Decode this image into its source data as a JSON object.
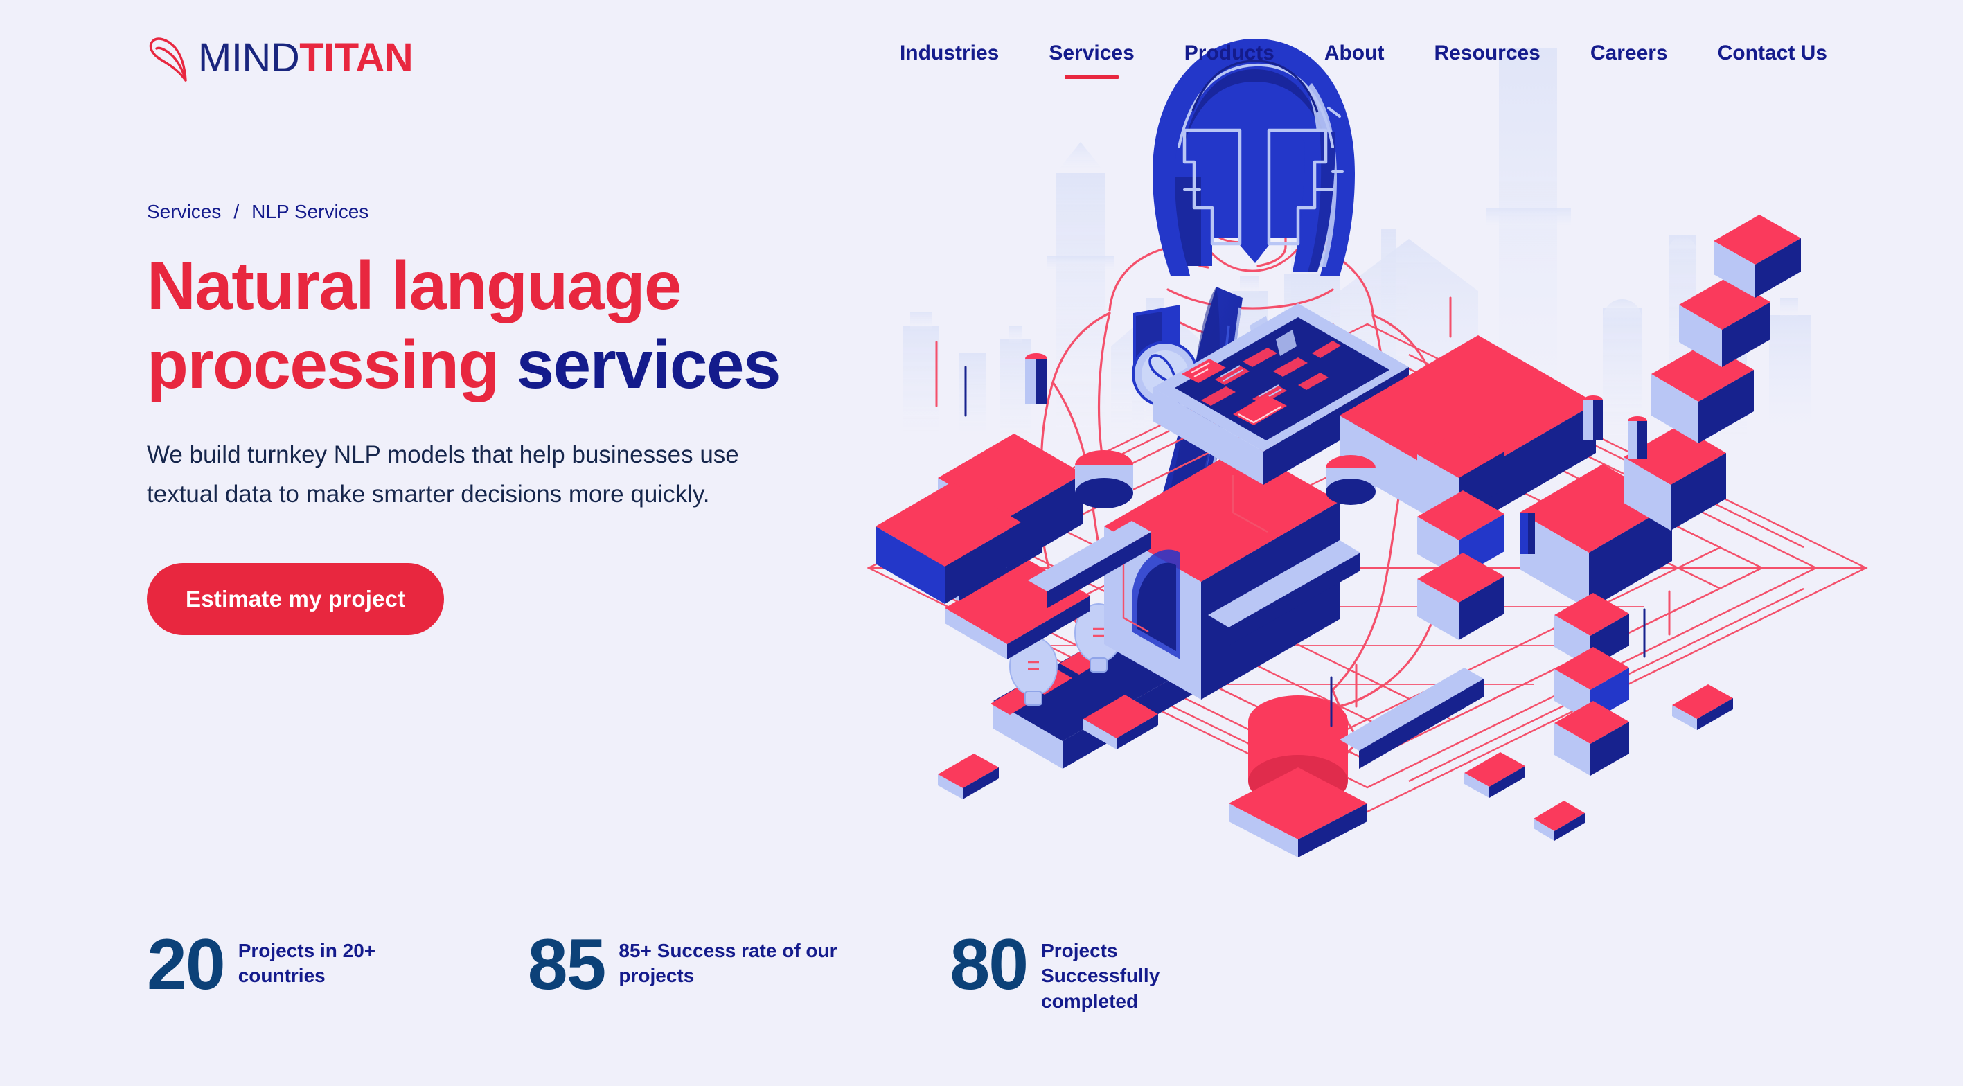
{
  "brand": {
    "mark_icon": "mindtitan-leaf-icon",
    "word_first": "MIND",
    "word_second": "TITAN"
  },
  "nav": {
    "items": [
      {
        "label": "Industries",
        "active": false
      },
      {
        "label": "Services",
        "active": true
      },
      {
        "label": "Products",
        "active": false
      },
      {
        "label": "About",
        "active": false
      },
      {
        "label": "Resources",
        "active": false
      },
      {
        "label": "Careers",
        "active": false
      },
      {
        "label": "Contact Us",
        "active": false
      }
    ]
  },
  "breadcrumb": {
    "parent": "Services",
    "separator": "/",
    "current": "NLP Services"
  },
  "hero": {
    "title_red": "Natural language processing",
    "title_blue": "services",
    "subtitle": "We build turnkey NLP models that help businesses use textual data to make smarter decisions more quickly.",
    "cta_label": "Estimate my project"
  },
  "stats": [
    {
      "number": "20",
      "label": "Projects in 20+ countries"
    },
    {
      "number": "85",
      "label": "85+ Success rate of our projects"
    },
    {
      "number": "80",
      "label": "Projects Successfully completed"
    }
  ],
  "illustration": {
    "name": "titan-warrior-isometric-nlp-factory",
    "description": "Spartan helmeted titan figure in red line-art with blue helmet and cape feeding documents into an isometric red and blue data-factory city"
  },
  "colors": {
    "background": "#f0f0fa",
    "brand_red": "#e8273f",
    "brand_navy": "#141b8c",
    "stat_navy": "#0c4178",
    "body_text": "#16264c",
    "helmet_blue": "#2337c9",
    "deep_navy": "#171f8c",
    "periwinkle": "#b9c6f5",
    "coral": "#fa3a5c",
    "line_red": "#f4506b",
    "skyline": "#e2e6fa"
  }
}
